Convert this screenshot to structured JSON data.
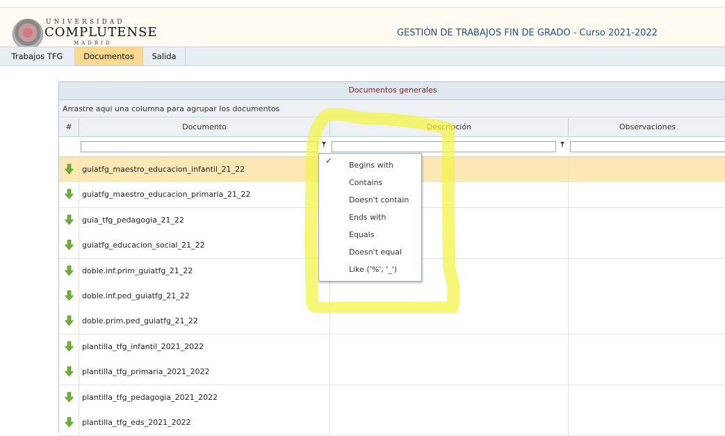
{
  "header": {
    "logo_line1": "UNIVERSIDAD",
    "logo_line2": "COMPLUTENSE",
    "logo_line3": "MADRID",
    "title": "GESTIÓN DE TRABAJOS FIN DE GRADO - Curso 2021-2022"
  },
  "menu": {
    "items": [
      {
        "label": "Trabajos TFG",
        "active": false
      },
      {
        "label": "Documentos",
        "active": true
      },
      {
        "label": "Salida",
        "active": false
      }
    ]
  },
  "grid": {
    "title": "Documentos generales",
    "group_hint": "Arrastre aqui una columna para agrupar los documentos",
    "columns": [
      {
        "label": "#"
      },
      {
        "label": "Documento"
      },
      {
        "label": "Descripción"
      },
      {
        "label": "Observaciones"
      }
    ],
    "rows": [
      {
        "documento": "guiatfg_maestro_educacion_infantil_21_22",
        "selected": true
      },
      {
        "documento": "guiatfg_maestro_educacion_primaria_21_22",
        "selected": false
      },
      {
        "documento": "guia_tfg_pedagogia_21_22",
        "selected": false
      },
      {
        "documento": "guiatfg_educacion_social_21_22",
        "selected": false
      },
      {
        "documento": "doble.inf.prim_guiatfg_21_22",
        "selected": false
      },
      {
        "documento": "doble.inf.ped_guiatfg_21_22",
        "selected": false
      },
      {
        "documento": "doble.prim.ped_guiatfg_21_22",
        "selected": false
      },
      {
        "documento": "plantilla_tfg_infantil_2021_2022",
        "selected": false
      },
      {
        "documento": "plantilla_tfg_primaria_2021_2022",
        "selected": false
      },
      {
        "documento": "plantilla_tfg_pedagogia_2021_2022",
        "selected": false
      },
      {
        "documento": "plantilla_tfg_eds_2021_2022",
        "selected": false
      }
    ]
  },
  "filter_menu": {
    "selected": "Begins with",
    "options": [
      "Begins with",
      "Contains",
      "Doesn't contain",
      "Ends with",
      "Equals",
      "Doesn't equal",
      "Like ('%', '_')"
    ]
  },
  "colors": {
    "header_bg": "#fefaf1",
    "title_color": "#1d4f8a",
    "menu_active": "#f8d98f",
    "selected_row": "#fbe8b4",
    "arrow_green": "#6db22f",
    "highlight_yellow": "#f7f75a"
  },
  "icons": {
    "row_icon": "download-arrow-icon",
    "filter_icon": "filter-pin-icon",
    "check_icon": "check-icon"
  }
}
